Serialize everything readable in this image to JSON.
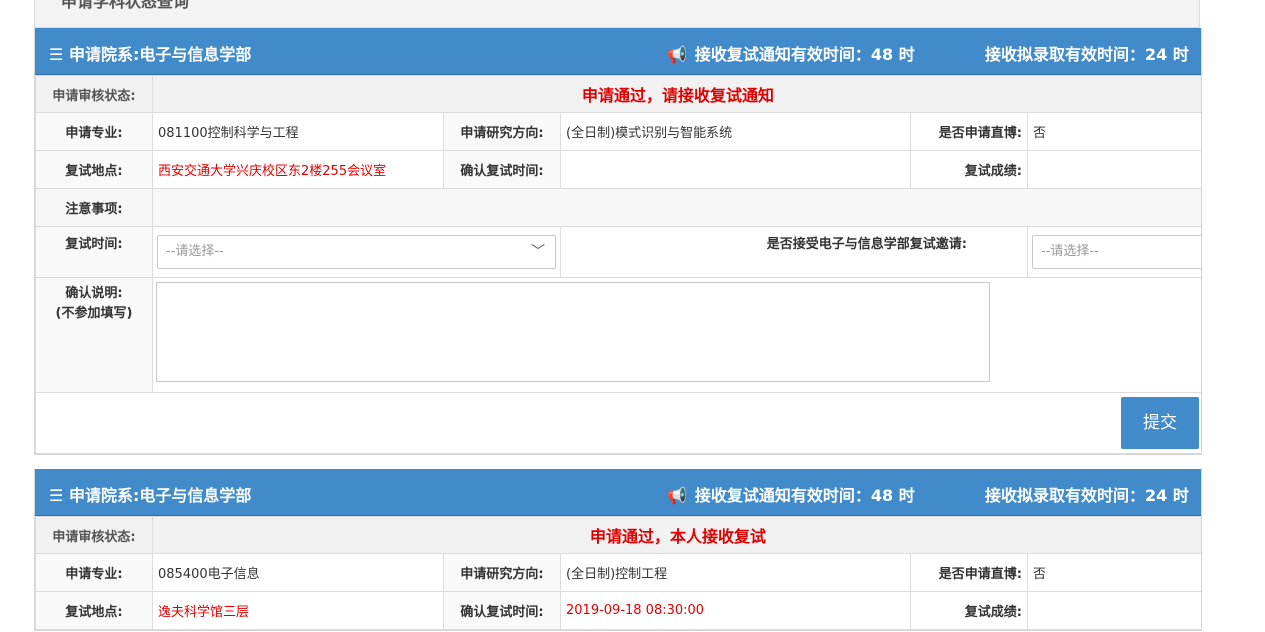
{
  "page_title": "申请学科状态查询",
  "panels": [
    {
      "dept_label": "申请院系:电子与信息学部",
      "notice1": "接收复试通知有效时间：48 时",
      "notice2": "接收拟录取有效时间：24 时",
      "status_label": "申请审核状态:",
      "status_text": "申请通过，请接收复试通知",
      "major_label": "申请专业:",
      "major_value": "081100控制科学与工程",
      "direction_label": "申请研究方向:",
      "direction_value": "(全日制)模式识别与智能系统",
      "direct_phd_label": "是否申请直博:",
      "direct_phd_value": "否",
      "location_label": "复试地点:",
      "location_value": "西安交通大学兴庆校区东2楼255会议室",
      "confirm_time_label": "确认复试时间:",
      "confirm_time_value": "",
      "score_label": "复试成绩:",
      "score_value": "",
      "notes_label": "注意事项:",
      "notes_value": "",
      "interview_time_label": "复试时间:",
      "interview_time_placeholder": "--请选择--",
      "accept_label": "是否接受电子与信息学部复试邀请:",
      "accept_placeholder": "--请选择--",
      "remark_label_1": "确认说明:",
      "remark_label_2": "(不参加填写)",
      "submit_label": "提交"
    },
    {
      "dept_label": "申请院系:电子与信息学部",
      "notice1": "接收复试通知有效时间：48 时",
      "notice2": "接收拟录取有效时间：24 时",
      "status_label": "申请审核状态:",
      "status_text": "申请通过，本人接收复试",
      "major_label": "申请专业:",
      "major_value": "085400电子信息",
      "direction_label": "申请研究方向:",
      "direction_value": "(全日制)控制工程",
      "direct_phd_label": "是否申请直博:",
      "direct_phd_value": "否",
      "location_label": "复试地点:",
      "location_value": "逸夫科学馆三层",
      "confirm_time_label": "确认复试时间:",
      "confirm_time_value": "2019-09-18 08:30:00",
      "score_label": "复试成绩:",
      "score_value": ""
    }
  ],
  "colors": {
    "header_bar": "#428bca",
    "status_red": "#e00000"
  }
}
